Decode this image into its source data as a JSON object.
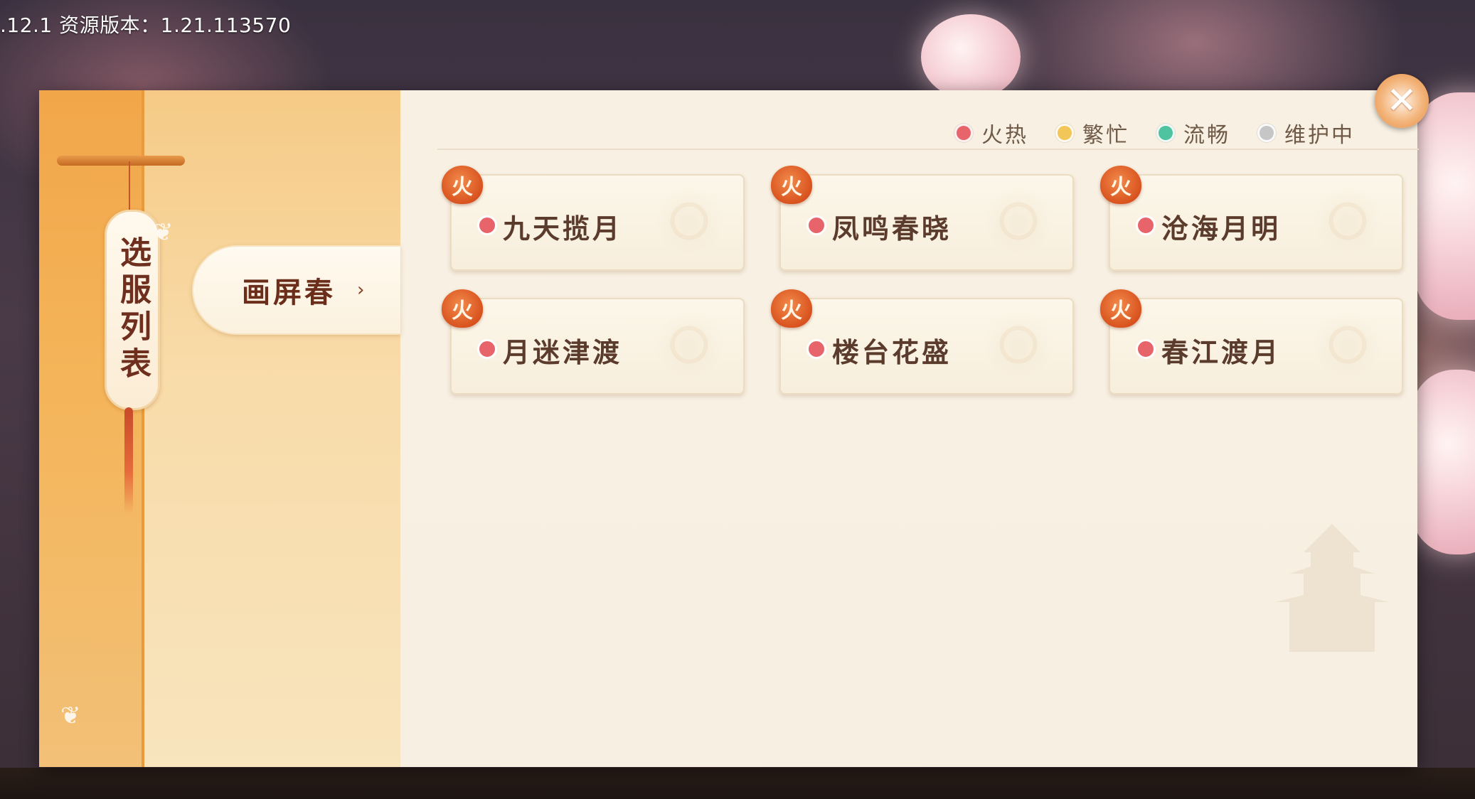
{
  "version_text": ".12.1 资源版本：1.21.113570",
  "sidebar": {
    "title": "选服列表",
    "regions": [
      {
        "label": "画屏春",
        "selected": true
      }
    ]
  },
  "legend": [
    {
      "label": "火热",
      "color": "#e7646a"
    },
    {
      "label": "繁忙",
      "color": "#f3c65a"
    },
    {
      "label": "流畅",
      "color": "#4fc3a0"
    },
    {
      "label": "维护中",
      "color": "#c6c6c6"
    }
  ],
  "servers": [
    {
      "name": "九天揽月",
      "badge": "火",
      "status_color": "#e7646a"
    },
    {
      "name": "凤鸣春晓",
      "badge": "火",
      "status_color": "#e7646a"
    },
    {
      "name": "沧海月明",
      "badge": "火",
      "status_color": "#e7646a"
    },
    {
      "name": "月迷津渡",
      "badge": "火",
      "status_color": "#e7646a"
    },
    {
      "name": "楼台花盛",
      "badge": "火",
      "status_color": "#e7646a"
    },
    {
      "name": "春江渡月",
      "badge": "火",
      "status_color": "#e7646a"
    }
  ],
  "close_glyph": "✕",
  "region_arrow": "›"
}
